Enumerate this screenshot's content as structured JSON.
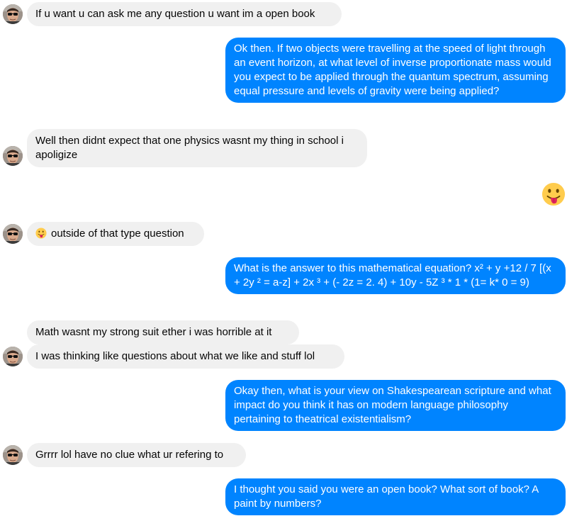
{
  "conversation": {
    "messages": [
      {
        "sender": "other",
        "text": "If u want u can ask me any question u want im a open book"
      },
      {
        "sender": "me",
        "text": "Ok then. If two objects were travelling at the speed of light through an event horizon, at what level of inverse proportionate mass would you expect to be applied through the quantum spectrum, assuming equal pressure and levels of gravity were being applied?"
      },
      {
        "sender": "other",
        "text": "Well then didnt expect that one physics wasnt my thing in school i apoligize"
      },
      {
        "sender": "me",
        "emoji": "tongue-out-emoji"
      },
      {
        "sender": "other",
        "emoji": "tongue-out-emoji",
        "text": "outside of that type question"
      },
      {
        "sender": "me",
        "text": "What is the answer to this mathematical equation? x² + y +12 / 7 [(x + 2y ² = a-z] + 2x ³ + (- 2z = 2. 4) + 10y - 5Z ³ * 1 * (1= k* 0 = 9)"
      },
      {
        "sender": "other",
        "text": "Math wasnt my strong suit ether i was horrible at it"
      },
      {
        "sender": "other",
        "text": "I was thinking like questions about what we like and stuff lol"
      },
      {
        "sender": "me",
        "text": "Okay then, what is your view on Shakespearean scripture and what impact do you think it has on modern language philosophy pertaining to theatrical existentialism?"
      },
      {
        "sender": "other",
        "text": "Grrrr lol have no clue what ur refering to"
      },
      {
        "sender": "me",
        "text": "I thought you said you were an open book? What sort of book? A paint by numbers?"
      }
    ]
  },
  "colors": {
    "outgoing_bubble": "#0084ff",
    "incoming_bubble": "#f0f0f0",
    "emoji_face": "#ffcc4d",
    "emoji_tongue": "#e0245e"
  }
}
